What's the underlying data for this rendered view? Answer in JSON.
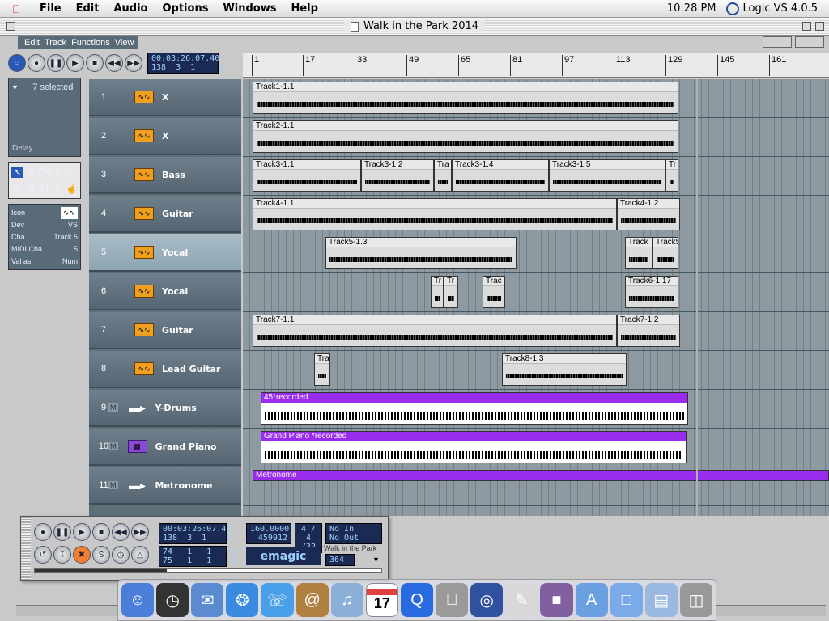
{
  "menubar": {
    "items": [
      "File",
      "Edit",
      "Audio",
      "Options",
      "Windows",
      "Help"
    ],
    "clock": "10:28 PM",
    "app_name": "Logic VS 4.0.5"
  },
  "window": {
    "title": "Walk in the Park 2014",
    "local_menu": [
      "Edit",
      "Track",
      "Functions",
      "View"
    ]
  },
  "transport": {
    "position_smpte": "00:03:26:07.40",
    "position_bars": "138  3  1     1"
  },
  "ruler": {
    "bars": [
      "1",
      "17",
      "33",
      "49",
      "65",
      "81",
      "97",
      "113",
      "129",
      "145",
      "161"
    ]
  },
  "inspector": {
    "selection": "7 selected",
    "delay_label": "Delay",
    "params": [
      {
        "k": "Icon",
        "v": ""
      },
      {
        "k": "Dev",
        "v": "VS"
      },
      {
        "k": "Cha",
        "v": "Track 5"
      },
      {
        "k": "MIDI Cha",
        "v": "5"
      },
      {
        "k": "Val as",
        "v": "Num"
      }
    ]
  },
  "tracks": [
    {
      "num": "1",
      "name": "X",
      "type": "audio"
    },
    {
      "num": "2",
      "name": "X",
      "type": "audio"
    },
    {
      "num": "3",
      "name": "Bass",
      "type": "audio"
    },
    {
      "num": "4",
      "name": "Guitar",
      "type": "audio"
    },
    {
      "num": "5",
      "name": "Yocal",
      "type": "audio",
      "selected": true
    },
    {
      "num": "6",
      "name": "Yocal",
      "type": "audio"
    },
    {
      "num": "7",
      "name": "Guitar",
      "type": "audio"
    },
    {
      "num": "8",
      "name": "Lead Guitar",
      "type": "audio"
    },
    {
      "num": "9",
      "name": "Y-Drums",
      "type": "midi",
      "m": "M"
    },
    {
      "num": "10",
      "name": "Grand Piano",
      "type": "synth",
      "m": "M"
    },
    {
      "num": "11",
      "name": "Metronome",
      "type": "metro",
      "m": "M"
    }
  ],
  "regions": [
    {
      "lane": 0,
      "name": "Track1-1.1",
      "start": 12,
      "end": 538
    },
    {
      "lane": 1,
      "name": "Track2-1.1",
      "start": 12,
      "end": 538
    },
    {
      "lane": 2,
      "name": "Track3-1.1",
      "start": 12,
      "end": 146
    },
    {
      "lane": 2,
      "name": "Track3-1.2",
      "start": 146,
      "end": 236
    },
    {
      "lane": 2,
      "name": "Tra",
      "start": 236,
      "end": 258
    },
    {
      "lane": 2,
      "name": "Track3-1.4",
      "start": 258,
      "end": 378
    },
    {
      "lane": 2,
      "name": "Track3-1.5",
      "start": 378,
      "end": 522
    },
    {
      "lane": 2,
      "name": "Tr",
      "start": 522,
      "end": 538
    },
    {
      "lane": 3,
      "name": "Track4-1.1",
      "start": 12,
      "end": 462
    },
    {
      "lane": 3,
      "name": "Track4-1.2",
      "start": 462,
      "end": 540
    },
    {
      "lane": 4,
      "name": "Track5-1.3",
      "start": 102,
      "end": 338
    },
    {
      "lane": 4,
      "name": "Track",
      "start": 472,
      "end": 506
    },
    {
      "lane": 4,
      "name": "Track5",
      "start": 506,
      "end": 538
    },
    {
      "lane": 5,
      "name": "Tr",
      "start": 232,
      "end": 248
    },
    {
      "lane": 5,
      "name": "Tr",
      "start": 248,
      "end": 266
    },
    {
      "lane": 5,
      "name": "Trac",
      "start": 296,
      "end": 324
    },
    {
      "lane": 5,
      "name": "Track6-1.17",
      "start": 472,
      "end": 538
    },
    {
      "lane": 6,
      "name": "Track7-1.1",
      "start": 12,
      "end": 462
    },
    {
      "lane": 6,
      "name": "Track7-1.2",
      "start": 462,
      "end": 540
    },
    {
      "lane": 7,
      "name": "Tra",
      "start": 88,
      "end": 108
    },
    {
      "lane": 7,
      "name": "Track8-1.3",
      "start": 320,
      "end": 474
    },
    {
      "lane": 8,
      "name": "45*recorded",
      "start": 22,
      "end": 550,
      "midi": true
    },
    {
      "lane": 9,
      "name": "Grand Piano *recorded",
      "start": 22,
      "end": 548,
      "midi": true
    },
    {
      "lane": 10,
      "name": "Metronome",
      "start": 12,
      "end": 724,
      "midi": true
    }
  ],
  "float_transport": {
    "smpte": "00:03:26:07.40",
    "bars": "138  3  1    1",
    "tempo": "160.0000",
    "ticks": "459912",
    "signature": "4 / 4",
    "division": "/32",
    "in": "No In",
    "out": "No Out",
    "left_locator": "74   1   1    1",
    "right_locator": "75   1   1    1",
    "brand": "emagic",
    "song": "Walk in the Park",
    "song_value": "364"
  },
  "dock": {
    "icons": [
      "finder",
      "clock",
      "mail",
      "safari",
      "ichat",
      "addressbook",
      "itunes",
      "ical",
      "quicktime",
      "sysprefs",
      "logic",
      "textedit",
      "preview",
      "apps",
      "folder",
      "docs",
      "trash"
    ],
    "ical_date": "17"
  }
}
